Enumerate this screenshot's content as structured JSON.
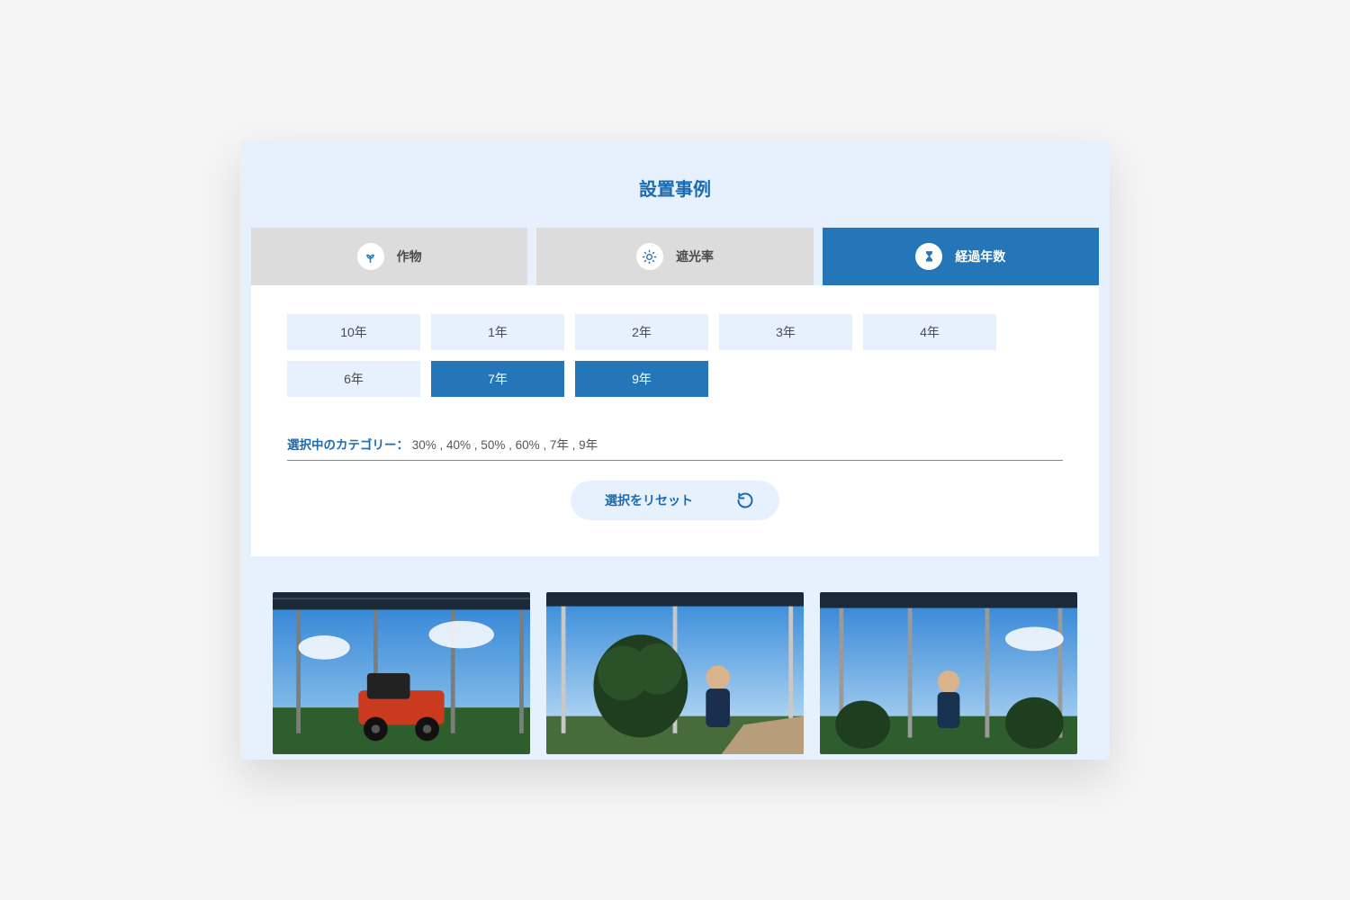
{
  "title": "設置事例",
  "tabs": [
    {
      "label": "作物",
      "active": false
    },
    {
      "label": "遮光率",
      "active": false
    },
    {
      "label": "経過年数",
      "active": true
    }
  ],
  "filters": [
    {
      "label": "10年",
      "selected": false
    },
    {
      "label": "1年",
      "selected": false
    },
    {
      "label": "2年",
      "selected": false
    },
    {
      "label": "3年",
      "selected": false
    },
    {
      "label": "4年",
      "selected": false
    },
    {
      "label": "6年",
      "selected": false
    },
    {
      "label": "7年",
      "selected": true
    },
    {
      "label": "9年",
      "selected": true
    }
  ],
  "selected_label": "選択中のカテゴリー：",
  "selected_values": "30% , 40% , 50% , 60% , 7年 , 9年",
  "reset_label": "選択をリセット"
}
